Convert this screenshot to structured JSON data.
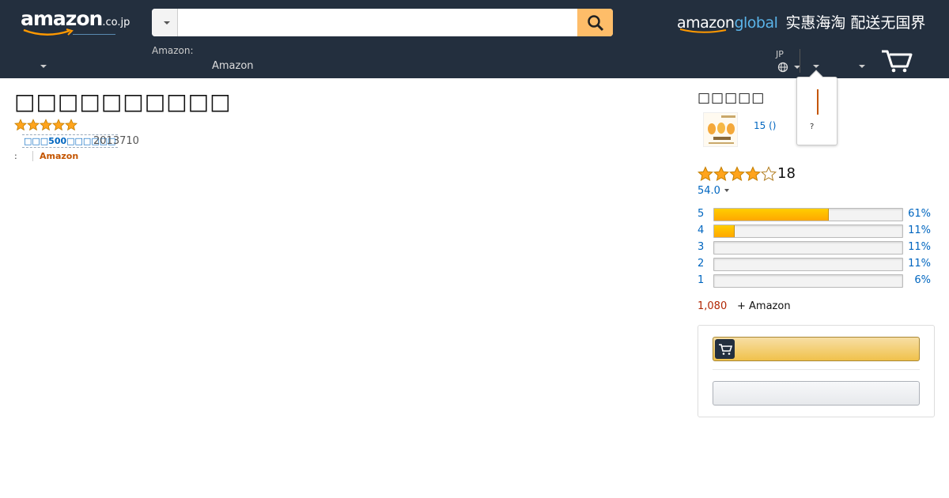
{
  "header": {
    "logo_text": "amazon",
    "logo_suffix": ".co.jp",
    "search_placeholder": "",
    "global_brand_1": "amazon",
    "global_brand_2": "global",
    "global_slogan": "实惠海淘 配送无国界",
    "nav_small_label": "Amazon:",
    "nav_category": "Amazon",
    "language_code": "JP",
    "icons": [
      "search-icon",
      "globe-icon",
      "cart-icon",
      "chevron-down-icon"
    ]
  },
  "popover": {
    "question": "?"
  },
  "product": {
    "title": "□□□□□□□□□□",
    "rating_stars": 5,
    "badge": "□□□500□□□□□□",
    "date": "2013710",
    "byline_colon": ":",
    "seller": "Amazon"
  },
  "sidebar": {
    "title": "□□□□□",
    "thumb_link": "15 ()",
    "average_stars": 4,
    "review_count": "18",
    "average_score": "54.0",
    "histogram": [
      {
        "label": "5",
        "percent": "61%",
        "fraction": 0.61
      },
      {
        "label": "4",
        "percent": "11%",
        "fraction": 0.11
      },
      {
        "label": "3",
        "percent": "11%",
        "fraction": 0.0
      },
      {
        "label": "2",
        "percent": "11%",
        "fraction": 0.0
      },
      {
        "label": "1",
        "percent": "6%",
        "fraction": 0.0
      }
    ],
    "price": "1,080",
    "shipping": "+ Amazon",
    "add_to_cart_label": "",
    "other_button_label": ""
  },
  "colors": {
    "nav_bg": "#232f3e",
    "search_button": "#febd69",
    "star": "#ffa41c",
    "link": "#0066c0",
    "price": "#b12704",
    "seller": "#c45500"
  }
}
